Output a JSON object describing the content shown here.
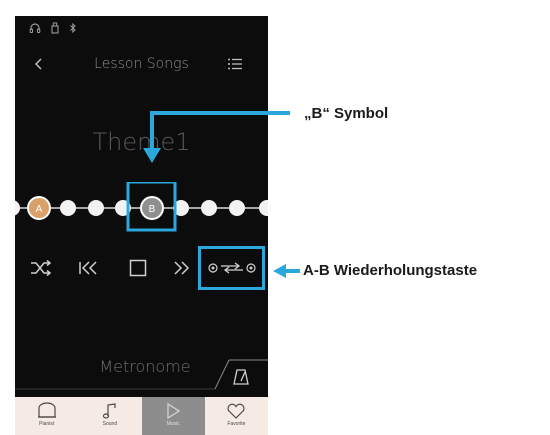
{
  "status_bar": {
    "icons": [
      "headphones-icon",
      "usb-icon",
      "bluetooth-icon"
    ]
  },
  "nav": {
    "back_icon": "chevron-left-icon",
    "title": "Lesson Songs",
    "list_icon": "list-icon"
  },
  "song": {
    "title": "Theme1"
  },
  "track": {
    "marker_a": "A",
    "marker_b": "B",
    "colors": {
      "a_marker": "#d9a06a",
      "b_marker": "#8f8f8f",
      "dot": "#f2f2f2"
    }
  },
  "controls": {
    "shuffle_icon": "shuffle-icon",
    "rewind_icon": "rewind-icon",
    "stop_icon": "stop-icon",
    "forward_icon": "fast-forward-icon",
    "ab_repeat_icon": "ab-repeat-icon"
  },
  "metronome": {
    "label": "Metronome",
    "icon": "metronome-icon"
  },
  "tabs": [
    {
      "label": "Pianist",
      "icon": "piano-icon"
    },
    {
      "label": "Sound",
      "icon": "note-icon"
    },
    {
      "label": "Music",
      "icon": "play-icon"
    },
    {
      "label": "Favorite",
      "icon": "heart-icon"
    }
  ],
  "annotations": {
    "b_symbol": "„B“ Symbol",
    "ab_repeat_button": "A-B Wiederholungstaste",
    "accent_color": "#2aa8dc"
  }
}
